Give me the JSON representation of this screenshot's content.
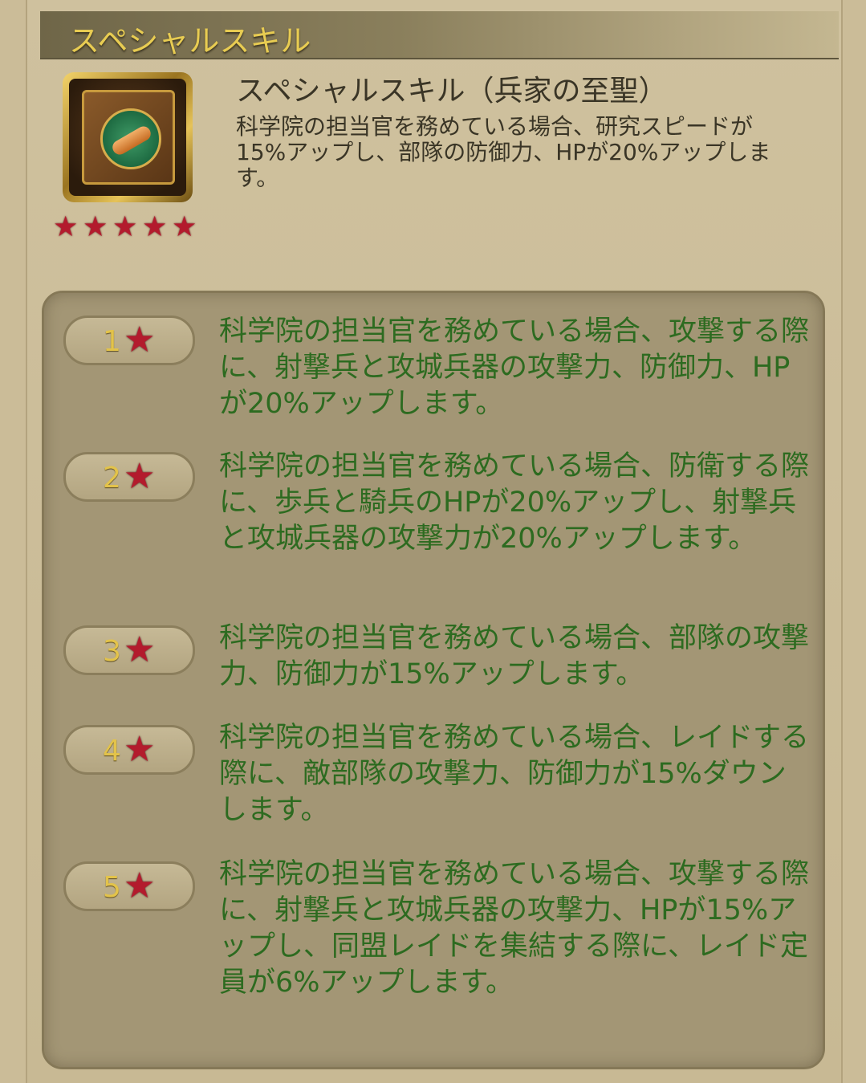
{
  "header": {
    "title": "スペシャルスキル"
  },
  "skill": {
    "icon": "book-scroll-icon",
    "name": "スペシャルスキル（兵家の至聖）",
    "description": "科学院の担当官を務めている場合、研究スピードが15%アップし、部隊の防御力、HPが20%アップします。",
    "stars": 5
  },
  "levels": [
    {
      "num": "1",
      "text": "科学院の担当官を務めている場合、攻撃する際に、射撃兵と攻城兵器の攻撃力、防御力、HPが20%アップします。"
    },
    {
      "num": "2",
      "text": "科学院の担当官を務めている場合、防衛する際に、歩兵と騎兵のHPが20%アップし、射撃兵と攻城兵器の攻撃力が20%アップします。"
    },
    {
      "num": "3",
      "text": "科学院の担当官を務めている場合、部隊の攻撃力、防御力が15%アップします。"
    },
    {
      "num": "4",
      "text": "科学院の担当官を務めている場合、レイドする際に、敵部隊の攻撃力、防御力が15%ダウンします。"
    },
    {
      "num": "5",
      "text": "科学院の担当官を務めている場合、攻撃する際に、射撃兵と攻城兵器の攻撃力、HPが15%アップし、同盟レイドを集結する際に、レイド定員が6%アップします。"
    }
  ],
  "colors": {
    "title": "#e8cc52",
    "levelText": "#2d6b20",
    "star": "#b31b2d"
  }
}
